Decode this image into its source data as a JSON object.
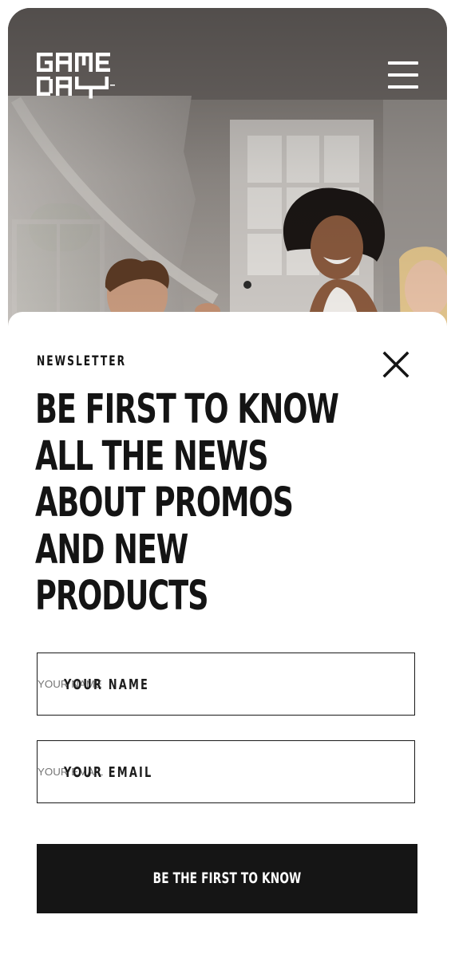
{
  "header": {
    "logo_text": [
      "GAME",
      "DAY"
    ],
    "menu_icon": "hamburger-menu-icon"
  },
  "newsletter": {
    "eyebrow": "NEWSLETTER",
    "close_icon": "close-icon",
    "headline_lines": [
      "BE FIRST TO KNOW",
      "ALL THE NEWS",
      "ABOUT PROMOS",
      "AND NEW",
      "PRODUCTS"
    ],
    "name_field": {
      "placeholder": "YOUR NAME",
      "value": ""
    },
    "email_field": {
      "placeholder": "YOUR EMAIL",
      "value": ""
    },
    "submit_label": "BE THE FIRST TO KNOW"
  },
  "colors": {
    "ink": "#141414",
    "button_background": "#151515",
    "sheet_background": "#ffffff"
  }
}
